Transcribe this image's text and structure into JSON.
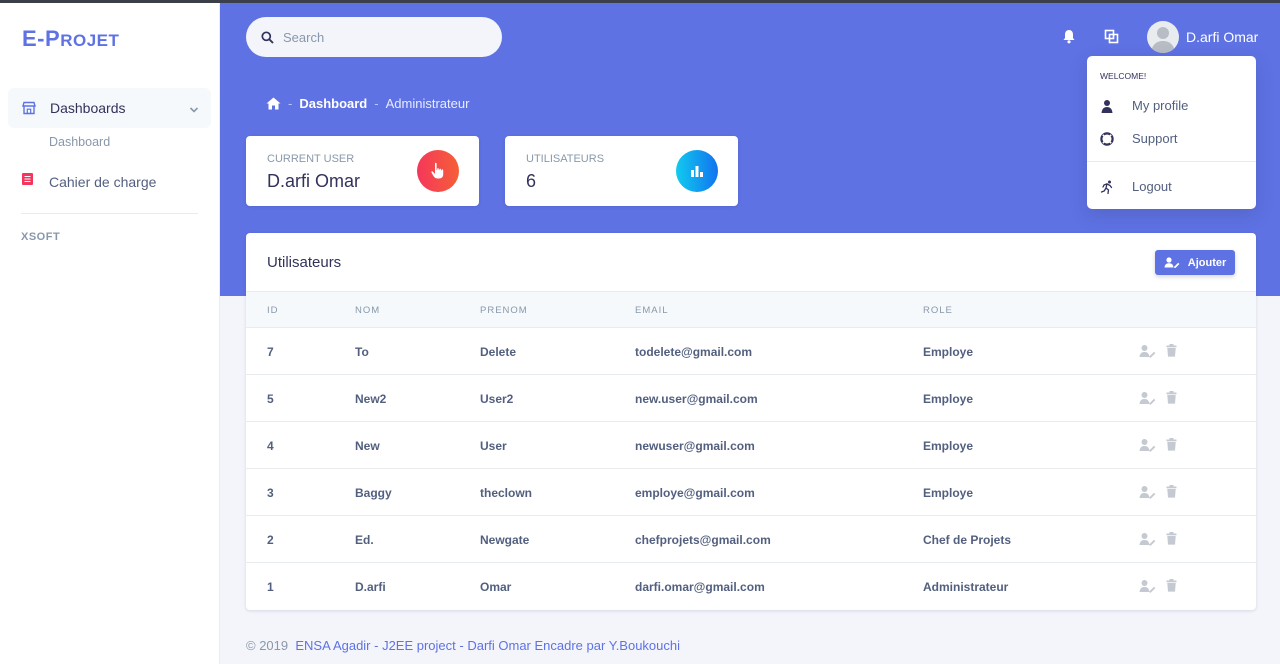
{
  "brand": {
    "main": "E-P",
    "small": "ROJET"
  },
  "sidebar": {
    "dashboards_label": "Dashboards",
    "dashboard_sub": "Dashboard",
    "cahier_label": "Cahier de charge",
    "section_label": "XSOFT"
  },
  "header": {
    "search_placeholder": "Search",
    "user_name": "D.arfi Omar"
  },
  "breadcrumb": {
    "level1": "Dashboard",
    "level2": "Administrateur"
  },
  "stats": [
    {
      "title": "Current user",
      "value": "D.arfi Omar",
      "color": "#f5365c",
      "icon": "hand-pointer-icon"
    },
    {
      "title": "Utilisateurs",
      "value": "6",
      "color": "#11cdef",
      "icon": "bar-chart-icon"
    }
  ],
  "table": {
    "title": "Utilisateurs",
    "add_label": "Ajouter",
    "columns": [
      "ID",
      "NOM",
      "PRENOM",
      "EMAIL",
      "ROLE"
    ],
    "rows": [
      {
        "id": "7",
        "nom": "To",
        "prenom": "Delete",
        "email": "todelete@gmail.com",
        "role": "Employe"
      },
      {
        "id": "5",
        "nom": "New2",
        "prenom": "User2",
        "email": "new.user@gmail.com",
        "role": "Employe"
      },
      {
        "id": "4",
        "nom": "New",
        "prenom": "User",
        "email": "newuser@gmail.com",
        "role": "Employe"
      },
      {
        "id": "3",
        "nom": "Baggy",
        "prenom": "theclown",
        "email": "employe@gmail.com",
        "role": "Employe"
      },
      {
        "id": "2",
        "nom": "Ed.",
        "prenom": "Newgate",
        "email": "chefprojets@gmail.com",
        "role": "Chef de Projets"
      },
      {
        "id": "1",
        "nom": "D.arfi",
        "prenom": "Omar",
        "email": "darfi.omar@gmail.com",
        "role": "Administrateur"
      }
    ]
  },
  "dropdown": {
    "welcome": "Welcome!",
    "items": [
      "My profile",
      "Support",
      "Logout"
    ]
  },
  "footer": {
    "copyright": "© 2019",
    "link": "ENSA Agadir - J2EE project - Darfi Omar Encadre par Y.Boukouchi"
  },
  "colors": {
    "primary": "#5e72e4",
    "danger": "#f5365c",
    "info": "#11cdef"
  }
}
